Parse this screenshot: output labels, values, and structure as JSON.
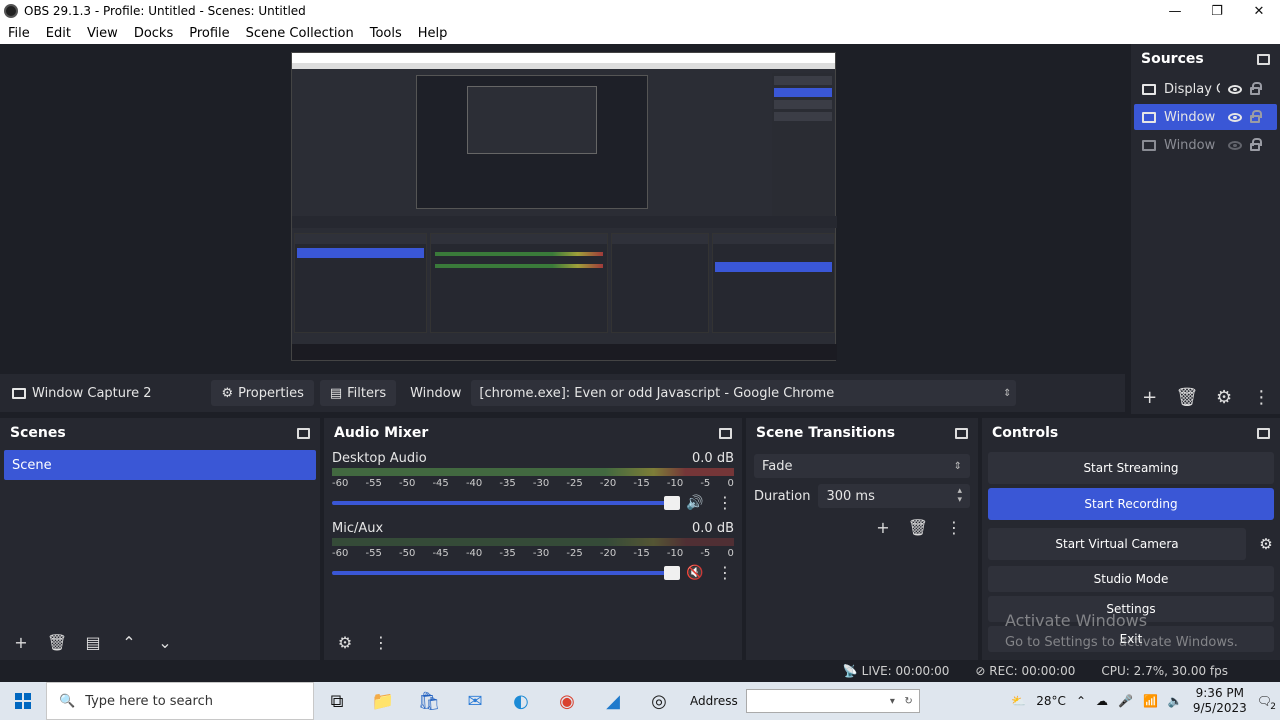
{
  "window": {
    "title": "OBS 29.1.3 - Profile: Untitled - Scenes: Untitled"
  },
  "menu": [
    "File",
    "Edit",
    "View",
    "Docks",
    "Profile",
    "Scene Collection",
    "Tools",
    "Help"
  ],
  "source_toolbar": {
    "selected_source": "Window Capture 2",
    "properties": "Properties",
    "filters": "Filters",
    "window_label": "Window",
    "window_value": "[chrome.exe]: Even or odd Javascript - Google Chrome"
  },
  "sources": {
    "title": "Sources",
    "items": [
      {
        "label": "Display C",
        "visible": true,
        "selected": false
      },
      {
        "label": "Window C",
        "visible": true,
        "selected": true
      },
      {
        "label": "Window C",
        "visible": false,
        "selected": false
      }
    ]
  },
  "scenes": {
    "title": "Scenes",
    "items": [
      "Scene"
    ]
  },
  "audio_mixer": {
    "title": "Audio Mixer",
    "channels": [
      {
        "name": "Desktop Audio",
        "level": "0.0 dB",
        "muted": false,
        "volume": 1.0
      },
      {
        "name": "Mic/Aux",
        "level": "0.0 dB",
        "muted": true,
        "volume": 1.0
      }
    ],
    "ticks": [
      "-60",
      "-55",
      "-50",
      "-45",
      "-40",
      "-35",
      "-30",
      "-25",
      "-20",
      "-15",
      "-10",
      "-5",
      "0"
    ]
  },
  "scene_transitions": {
    "title": "Scene Transitions",
    "transition": "Fade",
    "duration_label": "Duration",
    "duration_value": "300 ms"
  },
  "controls": {
    "title": "Controls",
    "start_streaming": "Start Streaming",
    "start_recording": "Start Recording",
    "start_virtual_camera": "Start Virtual Camera",
    "studio_mode": "Studio Mode",
    "settings": "Settings",
    "exit": "Exit"
  },
  "watermark": {
    "line1": "Activate Windows",
    "line2": "Go to Settings to activate Windows."
  },
  "status": {
    "live": "LIVE: 00:00:00",
    "rec": "REC: 00:00:00",
    "cpu": "CPU: 2.7%, 30.00 fps"
  },
  "taskbar": {
    "search_placeholder": "Type here to search",
    "address_label": "Address",
    "temperature": "28°C",
    "time": "9:36 PM",
    "date": "9/5/2023",
    "notification_count": "2"
  },
  "colors": {
    "accent": "#3a57d6",
    "panel": "#262830",
    "background": "#1d1f26"
  }
}
